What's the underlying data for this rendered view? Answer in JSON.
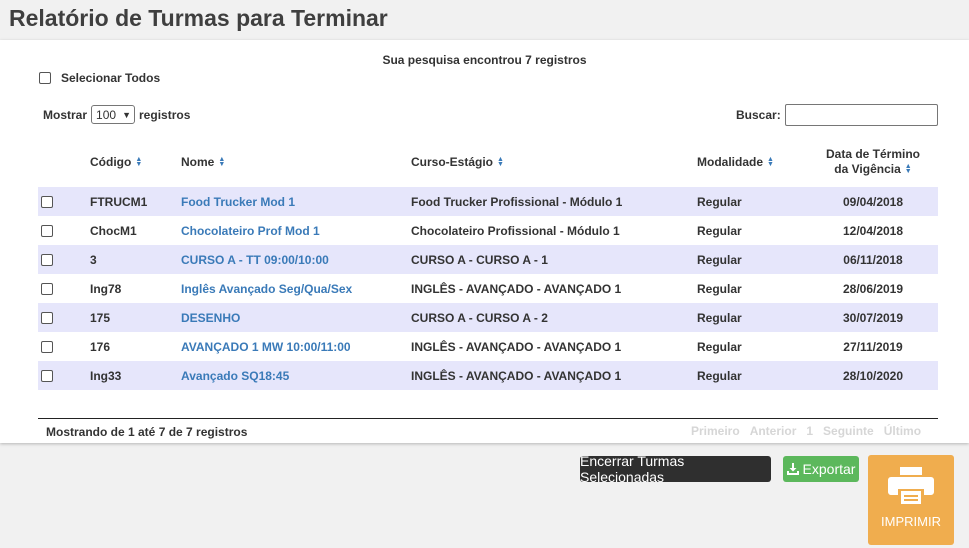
{
  "page": {
    "title": "Relatório de Turmas para Terminar"
  },
  "summary": {
    "found": "Sua pesquisa encontrou 7 registros"
  },
  "select_all": {
    "label": "Selecionar Todos"
  },
  "length": {
    "prefix": "Mostrar",
    "value": "100",
    "suffix": "registros"
  },
  "search": {
    "label": "Buscar:",
    "value": ""
  },
  "columns": {
    "codigo": "Código",
    "nome": "Nome",
    "curso": "Curso-Estágio",
    "modalidade": "Modalidade",
    "data_line1": "Data de Término",
    "data_line2": "da Vigência"
  },
  "rows": [
    {
      "codigo": "FTRUCM1",
      "nome": "Food Trucker Mod 1",
      "curso": "Food Trucker Profissional - Módulo 1",
      "modalidade": "Regular",
      "data": "09/04/2018"
    },
    {
      "codigo": "ChocM1",
      "nome": "Chocolateiro Prof Mod 1",
      "curso": "Chocolateiro Profissional - Módulo 1",
      "modalidade": "Regular",
      "data": "12/04/2018"
    },
    {
      "codigo": "3",
      "nome": "CURSO A - TT 09:00/10:00",
      "curso": "CURSO A - CURSO A - 1",
      "modalidade": "Regular",
      "data": "06/11/2018"
    },
    {
      "codigo": "Ing78",
      "nome": "Inglês Avançado Seg/Qua/Sex",
      "curso": "INGLÊS - AVANÇADO - AVANÇADO 1",
      "modalidade": "Regular",
      "data": "28/06/2019"
    },
    {
      "codigo": "175",
      "nome": "DESENHO",
      "curso": "CURSO A - CURSO A - 2",
      "modalidade": "Regular",
      "data": "30/07/2019"
    },
    {
      "codigo": "176",
      "nome": "AVANÇADO 1 MW 10:00/11:00",
      "curso": "INGLÊS - AVANÇADO - AVANÇADO 1",
      "modalidade": "Regular",
      "data": "27/11/2019"
    },
    {
      "codigo": "Ing33",
      "nome": "Avançado SQ18:45",
      "curso": "INGLÊS - AVANÇADO - AVANÇADO 1",
      "modalidade": "Regular",
      "data": "28/10/2020"
    }
  ],
  "footer": {
    "info": "Mostrando de 1 até 7 de 7 registros"
  },
  "pagination": {
    "first": "Primeiro",
    "previous": "Anterior",
    "current": "1",
    "next": "Seguinte",
    "last": "Último"
  },
  "actions": {
    "close_selected": "Encerrar Turmas Selecionadas",
    "export": "Exportar",
    "print": "IMPRIMIR"
  },
  "icons": {
    "sort": "sort-icon",
    "download": "download-icon",
    "printer": "printer-icon"
  },
  "colors": {
    "link": "#3a7ab8",
    "row_stripe": "#e6e6fb",
    "export_green": "#5cb85c",
    "print_orange": "#f0ad4e",
    "dark_button": "#2f2f2f"
  }
}
